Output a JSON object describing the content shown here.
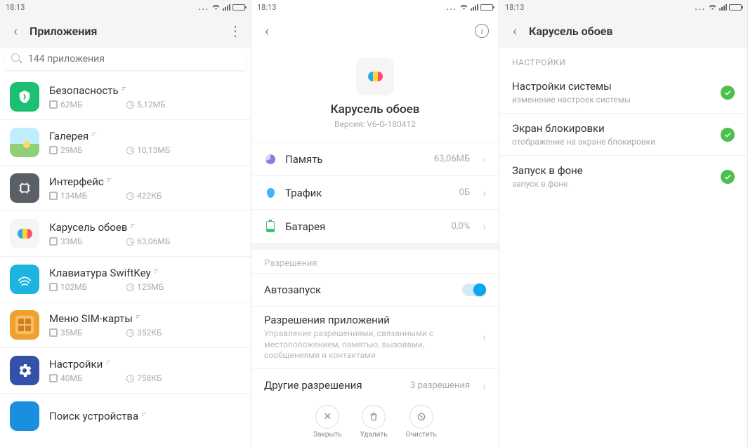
{
  "status": {
    "time": "18:13"
  },
  "pane1": {
    "title": "Приложения",
    "search_placeholder": "144 приложения",
    "apps": [
      {
        "name": "Безопасность",
        "mem": "62МБ",
        "cache": "5,12МБ"
      },
      {
        "name": "Галерея",
        "mem": "29МБ",
        "cache": "10,13МБ"
      },
      {
        "name": "Интерфейс",
        "mem": "134МБ",
        "cache": "422КБ"
      },
      {
        "name": "Карусель обоев",
        "mem": "33МБ",
        "cache": "63,06МБ"
      },
      {
        "name": "Клавиатура SwiftKey",
        "mem": "102МБ",
        "cache": "125МБ"
      },
      {
        "name": "Меню SIM-карты",
        "mem": "35МБ",
        "cache": "352КБ"
      },
      {
        "name": "Настройки",
        "mem": "40МБ",
        "cache": "758КБ"
      },
      {
        "name": "Поиск устройства",
        "mem": "",
        "cache": ""
      }
    ]
  },
  "pane2": {
    "app_name": "Карусель обоев",
    "version": "Версия: V6-G-180412",
    "rows": [
      {
        "label": "Память",
        "value": "63,06МБ"
      },
      {
        "label": "Трафик",
        "value": "0Б"
      },
      {
        "label": "Батарея",
        "value": "0,0%"
      }
    ],
    "section_perm": "Разрешения",
    "autostart": "Автозапуск",
    "appperm_title": "Разрешения приложений",
    "appperm_sub": "Управление разрешениями, связанными с местоположением, памятью, вызовами, сообщениями и контактами",
    "other_title": "Другие разрешения",
    "other_val": "3 разрешения",
    "actions": [
      {
        "label": "Закрыть"
      },
      {
        "label": "Удалить"
      },
      {
        "label": "Очистить"
      }
    ]
  },
  "pane3": {
    "title": "Карусель обоев",
    "section": "НАСТРОЙКИ",
    "items": [
      {
        "title": "Настройки системы",
        "sub": "изменение настроек системы"
      },
      {
        "title": "Экран блокировки",
        "sub": "отображение на экране блокировки"
      },
      {
        "title": "Запуск в фоне",
        "sub": "запуск в фоне"
      }
    ]
  }
}
